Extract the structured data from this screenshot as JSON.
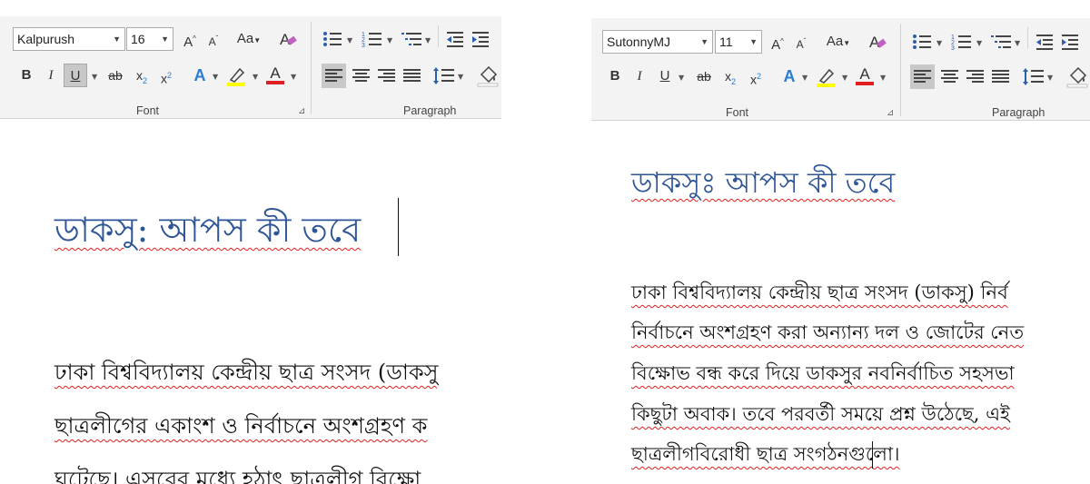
{
  "left": {
    "font": {
      "name": "Kalpurush",
      "size": "16",
      "group_label": "Font"
    },
    "paragraph": {
      "group_label": "Paragraph"
    },
    "buttons": {
      "grow": "A",
      "shrink": "A",
      "case": "Aa",
      "bold": "B",
      "italic": "I",
      "underline": "U",
      "strike": "ab",
      "sub": "x",
      "sup": "x",
      "text_effect": "A",
      "font_color": "A"
    },
    "document": {
      "title": "ডাকসু: আপস কী তবে",
      "lines": [
        "ঢাকা বিশ্ববিদ্যালয় কেন্দ্রীয় ছাত্র সংসদ (ডাকসু",
        "ছাত্রলীগের একাংশ ও নির্বাচনে অংশগ্রহণ ক",
        "ঘটেছে। এসবের মধ্যে হঠাৎ ছাত্রলীগ বিক্ষো"
      ]
    }
  },
  "right": {
    "font": {
      "name": "SutonnyMJ",
      "size": "11",
      "group_label": "Font"
    },
    "paragraph": {
      "group_label": "Paragraph"
    },
    "buttons": {
      "grow": "A",
      "shrink": "A",
      "case": "Aa",
      "bold": "B",
      "italic": "I",
      "underline": "U",
      "strike": "ab",
      "sub": "x",
      "sup": "x",
      "text_effect": "A",
      "font_color": "A"
    },
    "document": {
      "title": "ডাকসুঃ আপস কী তবে",
      "lines": [
        "ঢাকা বিশ্ববিদ্যালয় কেন্দ্রীয় ছাত্র সংসদ (ডাকসু) নির্ব",
        "নির্বাচনে অংশগ্রহণ করা অন্যান্য দল ও জোটের নেত",
        "বিক্ষোভ বন্ধ করে দিয়ে ডাকসুর নবনির্বাচিত সহসভা",
        "কিছুটা অবাক। তবে পরবর্তী সময়ে প্রশ্ন উঠেছে, এই",
        "ছাত্রলীগবিরোধী ছাত্র সংগঠনগুলো।"
      ]
    }
  },
  "colors": {
    "title_blue": "#2e5597",
    "highlight_yellow": "#ffff00",
    "font_color_red": "#e02020",
    "text_effect_blue": "#2b7cd3",
    "ribbon_bg": "#f3f3f3",
    "spellcheck_red": "#e02020"
  }
}
